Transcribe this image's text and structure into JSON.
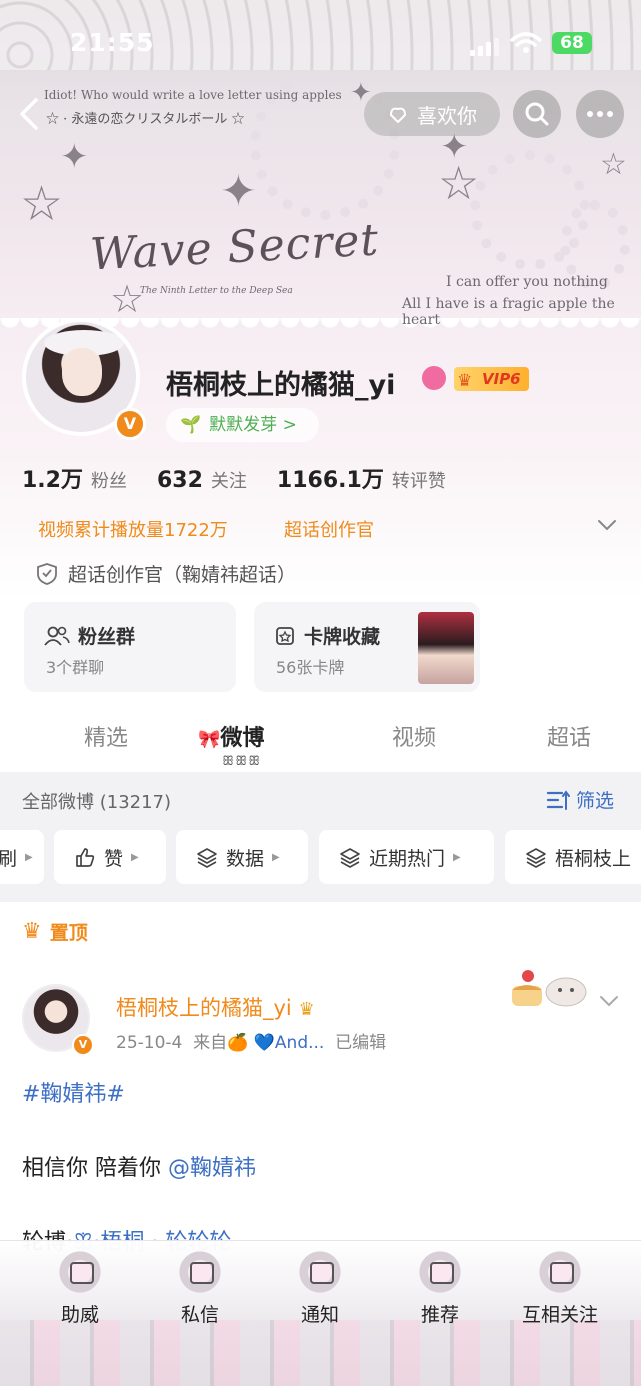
{
  "status_bar": {
    "time": "21:55",
    "battery": "68"
  },
  "banner": {
    "top_text": "Idiot! Who would write a love letter using apples",
    "sub_text": "☆ · 永遠の恋クリスタルボール ☆",
    "title": "Wave Secret",
    "subtitle": "The Ninth Letter to the Deep Sea",
    "quote_line1": "I can offer you nothing",
    "quote_line2": "All I have is a fragic apple the heart",
    "like_label": "喜欢你"
  },
  "profile": {
    "name": "梧桐枝上的橘猫_yi",
    "vip_label": "VIP6",
    "sprout_label": "默默发芽 >",
    "stats": [
      {
        "value": "1.2万",
        "label": "粉丝"
      },
      {
        "value": "632",
        "label": "关注"
      },
      {
        "value": "1166.1万",
        "label": "转评赞"
      }
    ],
    "video_plays": "视频累计播放量1722万",
    "super_creator": "超话创作官",
    "shield_text": "超话创作官（鞠婧祎超话）"
  },
  "cards": [
    {
      "title": "粉丝群",
      "sub": "3个群聊"
    },
    {
      "title": "卡牌收藏",
      "sub": "56张卡牌"
    }
  ],
  "tabs": [
    "精选",
    "微博",
    "视频",
    "超话"
  ],
  "tab_deco": "ꕥꕥꕥ",
  "feed": {
    "all_label": "全部微博 (13217)",
    "filter_label": "筛选",
    "chips": [
      "刷",
      "赞",
      "数据",
      "近期热门",
      "梧桐枝上"
    ]
  },
  "post": {
    "pinned_label": "置顶",
    "author": "梧桐枝上的橘猫_yi",
    "date": "25-10-4",
    "from": "来自🍊",
    "device": "💙And...",
    "edited": "已编辑",
    "hashtag": "#鞠婧祎#",
    "body_text": "相信你 陪着你 ",
    "mention": "@鞠婧祎",
    "cut_text": "轮博",
    "cut_link": "·ꕥ·梧桐 · 轮轮轮"
  },
  "bottom_nav": [
    "助威",
    "私信",
    "通知",
    "推荐",
    "互相关注"
  ],
  "colors": {
    "orange": "#f08a1a",
    "link_blue": "#3c6fc5",
    "sprout_green": "#4caf50"
  }
}
